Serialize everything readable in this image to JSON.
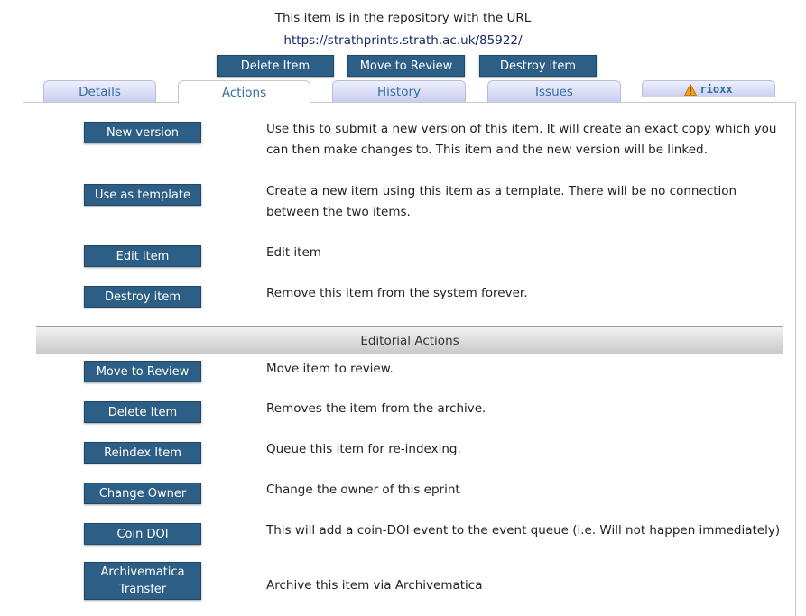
{
  "header": {
    "repo_line": "This item is in the repository with the URL",
    "repo_url": "https://strathprints.strath.ac.uk/85922/"
  },
  "top_buttons": {
    "delete": "Delete Item",
    "move_review": "Move to Review",
    "destroy": "Destroy item"
  },
  "tabs": {
    "details": "Details",
    "actions": "Actions",
    "history": "History",
    "issues": "Issues",
    "rioxx": "rioxx",
    "rioxx_icon": "warning-icon",
    "active": "Actions"
  },
  "actions": [
    {
      "label": "New version",
      "desc": "Use this to submit a new version of this item. It will create an exact copy which you can then make changes to. This item and the new version will be linked."
    },
    {
      "label": "Use as template",
      "desc": "Create a new item using this item as a template. There will be no connection between the two items."
    },
    {
      "label": "Edit item",
      "desc": "Edit item"
    },
    {
      "label": "Destroy item",
      "desc": "Remove this item from the system forever."
    }
  ],
  "editorial": {
    "heading": "Editorial Actions",
    "items": [
      {
        "label": "Move to Review",
        "desc": "Move item to review."
      },
      {
        "label": "Delete Item",
        "desc": "Removes the item from the archive."
      },
      {
        "label": "Reindex Item",
        "desc": "Queue this item for re-indexing."
      },
      {
        "label": "Change Owner",
        "desc": "Change the owner of this eprint"
      },
      {
        "label": "Coin DOI",
        "desc": "This will add a coin-DOI event to the event queue (i.e. Will not happen immediately)"
      },
      {
        "label": "Archivematica Transfer",
        "desc": "Archive this item via Archivematica"
      }
    ]
  },
  "colors": {
    "button": "#2c5e86",
    "tab_text": "#2f6fa0",
    "link": "#1a2a66",
    "warning": "#f0a020"
  }
}
